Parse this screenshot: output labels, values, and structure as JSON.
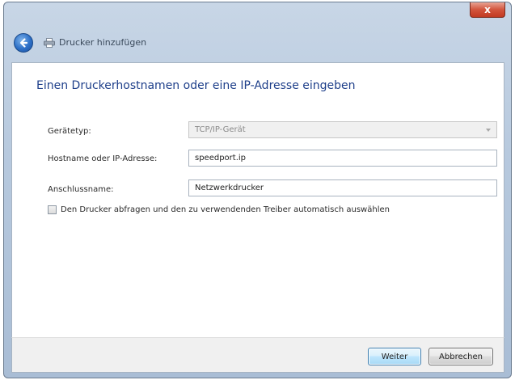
{
  "window": {
    "title": "Drucker hinzufügen",
    "close_label": "x"
  },
  "dialog": {
    "heading": "Einen Druckerhostnamen oder eine IP-Adresse eingeben",
    "device_type": {
      "label": "Gerätetyp:",
      "value": "TCP/IP-Gerät"
    },
    "hostname": {
      "label": "Hostname oder IP-Adresse:",
      "value": "speedport.ip"
    },
    "port_name": {
      "label": "Anschlussname:",
      "value": "Netzwerkdrucker"
    },
    "auto_driver_checkbox": {
      "label": "Den Drucker abfragen und den zu verwendenden Treiber automatisch auswählen",
      "checked": false
    }
  },
  "footer": {
    "next_label": "Weiter",
    "cancel_label": "Abbrechen"
  },
  "icons": {
    "back": "back-arrow-icon",
    "printer": "printer-icon",
    "close": "close-icon",
    "dropdown": "chevron-down-icon"
  },
  "colors": {
    "heading": "#1e3f8a",
    "titlebar": "#b7c9de",
    "close_button": "#d2543c",
    "primary_button_border": "#3c7fb1"
  }
}
